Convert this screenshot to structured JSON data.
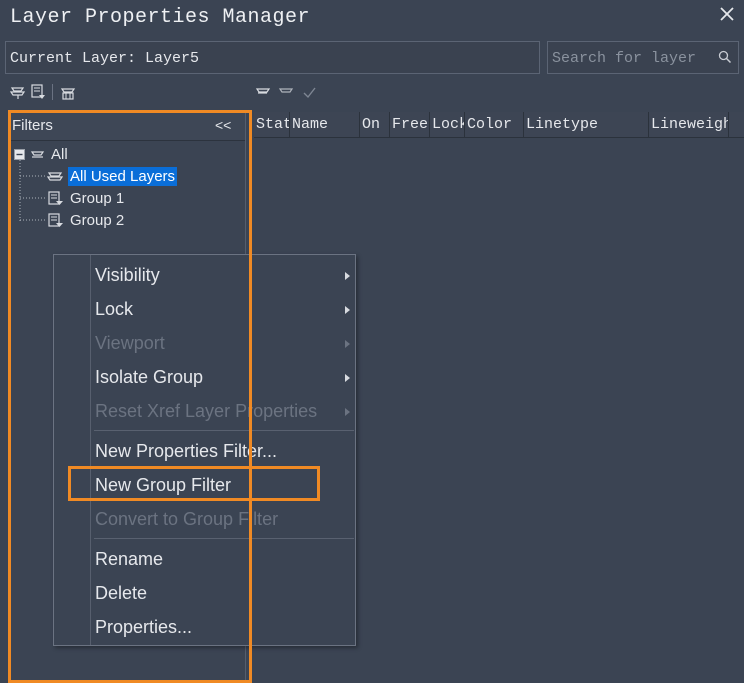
{
  "window": {
    "title": "Layer Properties Manager"
  },
  "current_layer": {
    "text": "Current Layer: Layer5"
  },
  "search": {
    "placeholder": "Search for layer"
  },
  "filters": {
    "header": "Filters",
    "collapse": "<<",
    "tree": {
      "root": "All",
      "children": [
        "All Used Layers",
        "Group 1",
        "Group 2"
      ]
    }
  },
  "grid": {
    "columns": [
      "Stat",
      "Name",
      "On",
      "Free",
      "Lock",
      "Color",
      "Linetype",
      "Lineweight"
    ]
  },
  "context_menu": {
    "items": [
      {
        "label": "Visibility",
        "submenu": true,
        "enabled": true
      },
      {
        "label": "Lock",
        "submenu": true,
        "enabled": true
      },
      {
        "label": "Viewport",
        "submenu": true,
        "enabled": false
      },
      {
        "label": "Isolate Group",
        "submenu": true,
        "enabled": true
      },
      {
        "label": "Reset Xref Layer Properties",
        "submenu": true,
        "enabled": false
      },
      {
        "label": "New Properties Filter...",
        "submenu": false,
        "enabled": true
      },
      {
        "label": "New Group Filter",
        "submenu": false,
        "enabled": true
      },
      {
        "label": "Convert to Group Filter",
        "submenu": false,
        "enabled": false
      },
      {
        "label": "Rename",
        "submenu": false,
        "enabled": true
      },
      {
        "label": "Delete",
        "submenu": false,
        "enabled": true
      },
      {
        "label": "Properties...",
        "submenu": false,
        "enabled": true
      }
    ]
  },
  "colors": {
    "highlight": "#f08a24",
    "selection": "#0a6ed8"
  }
}
